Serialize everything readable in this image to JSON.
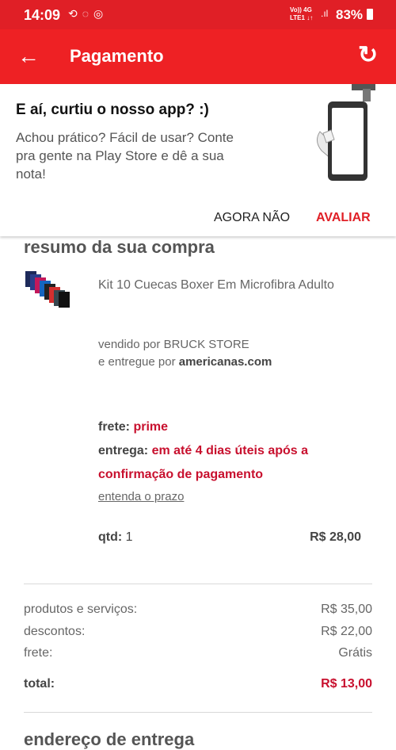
{
  "status_bar": {
    "time": "14:09",
    "network_line1": "Vo)) 4G",
    "network_line2": "LTE1 ↓↑",
    "battery": "83%"
  },
  "app_bar": {
    "title": "Pagamento",
    "back_icon": "arrow-left-icon",
    "refresh_icon": "refresh-icon"
  },
  "rating_prompt": {
    "heading": "E aí, curtiu o nosso app? :)",
    "body": "Achou prático? Fácil de usar? Conte pra gente na Play Store e dê a sua nota!",
    "later_label": "AGORA NÃO",
    "rate_label": "AVALIAR"
  },
  "summary": {
    "title": "resumo da sua compra",
    "product_name": "Kit 10 Cuecas Boxer Em Microfibra Adulto",
    "sold_by_prefix": "vendido por",
    "sold_by": "BRUCK STORE",
    "delivered_by_prefix": "e entregue por",
    "delivered_by": "americanas.com",
    "freight_label": "frete:",
    "freight_value": "prime",
    "delivery_label": "entrega:",
    "delivery_value": "em até 4 dias úteis após a confirmação de pagamento",
    "understand_link": "entenda o prazo",
    "qty_label": "qtd:",
    "qty_value": "1",
    "item_price": "R$ 28,00"
  },
  "totals": {
    "rows": [
      {
        "label": "produtos e serviços:",
        "value": "R$ 35,00"
      },
      {
        "label": "descontos:",
        "value": "R$ 22,00"
      },
      {
        "label": "frete:",
        "value": "Grátis"
      }
    ],
    "total_label": "total:",
    "total_value": "R$ 13,00"
  },
  "address": {
    "title": "endereço de entrega"
  },
  "colors": {
    "status_bar": "#e01f26",
    "app_bar": "#ee2124",
    "accent_red": "#c8102e"
  }
}
